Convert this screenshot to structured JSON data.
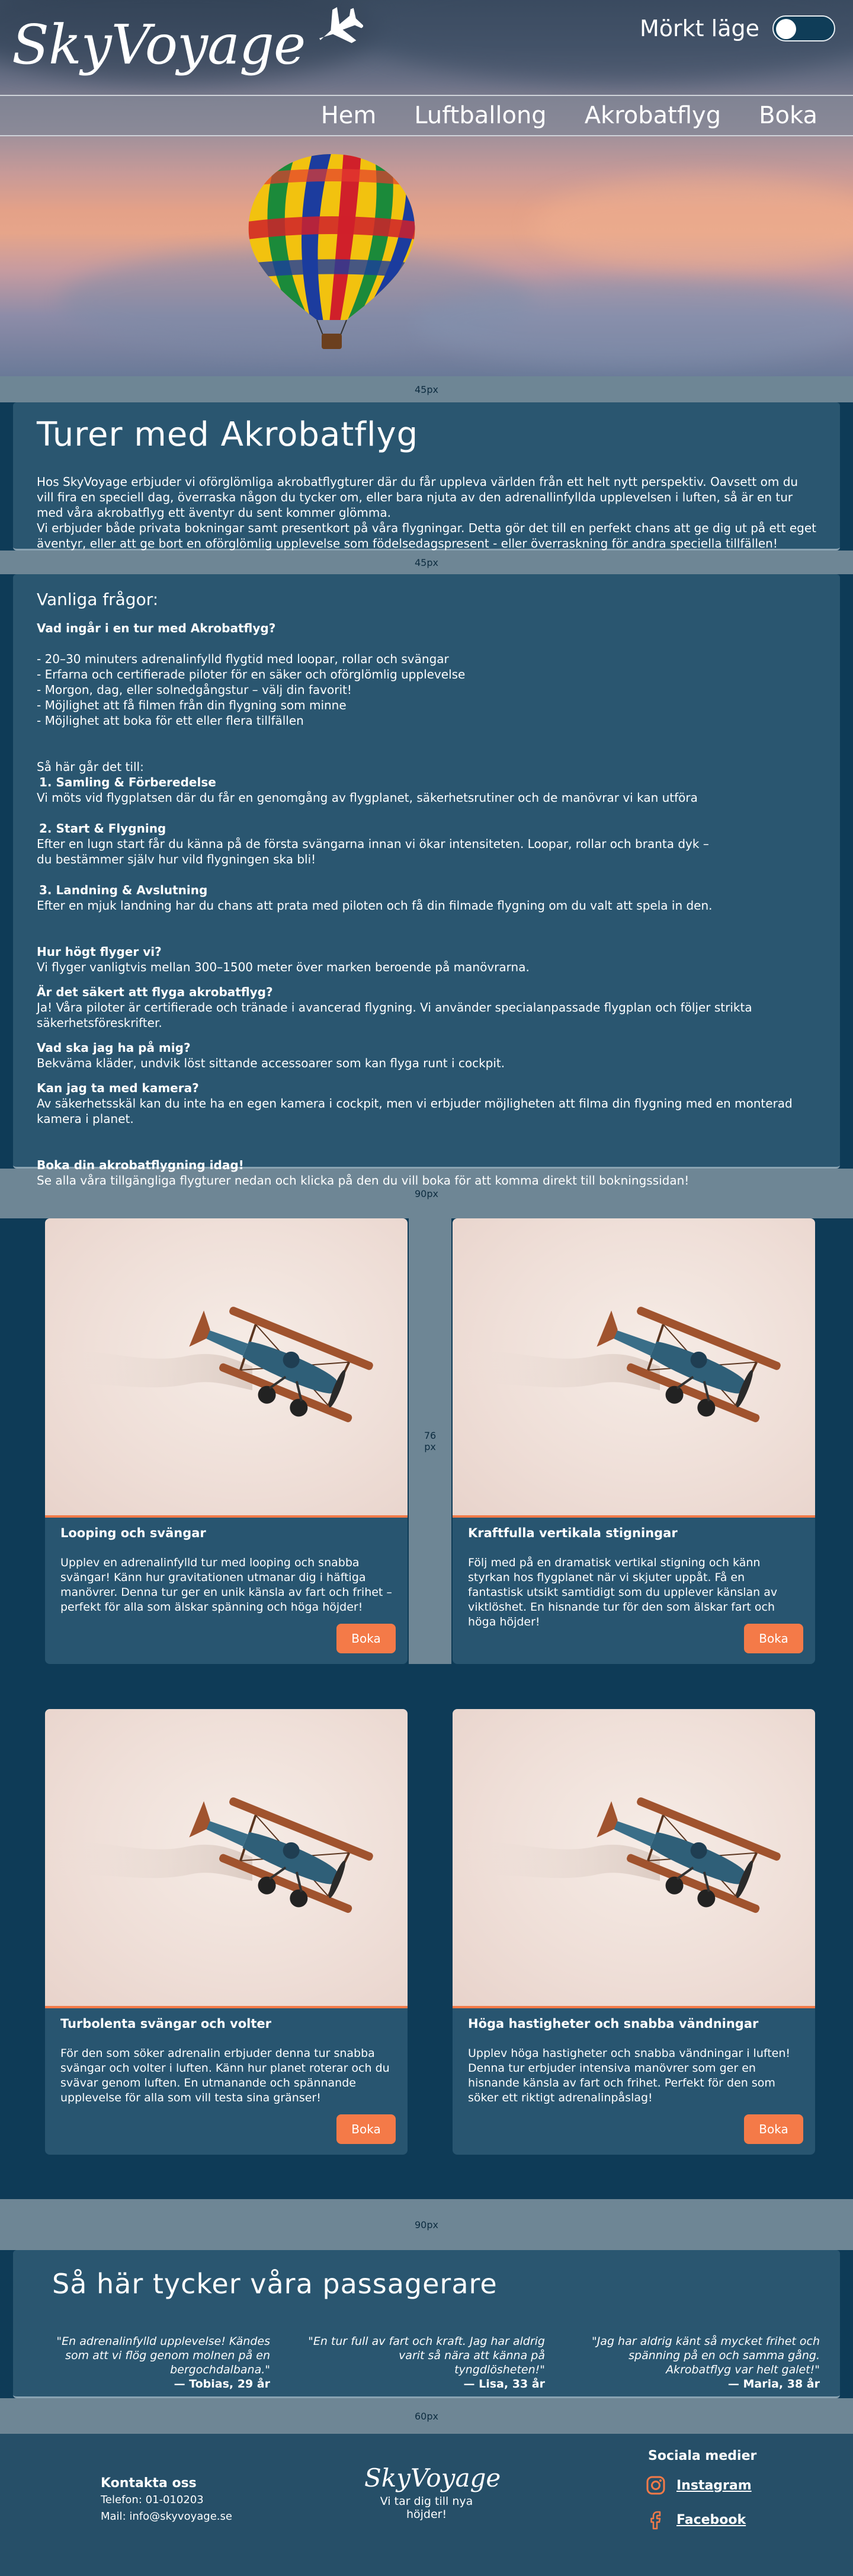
{
  "header": {
    "logo": "SkyVoyage",
    "dark_mode_label": "Mörkt läge",
    "nav": [
      "Hem",
      "Luftballong",
      "Akrobatflyg",
      "Boka"
    ]
  },
  "bands": {
    "b1": "45px",
    "b2": "45px",
    "b3": "90px",
    "b4": "90px",
    "b5": "60px",
    "mid": "76 px"
  },
  "intro": {
    "title": "Turer med Akrobatflyg",
    "p1": "Hos SkyVoyage erbjuder vi oförglömliga akrobatflygturer där du får uppleva världen från ett helt nytt perspektiv. Oavsett om du vill fira en speciell dag, överraska någon du tycker om, eller bara njuta av den adrenallinfyllda upplevelsen i luften, så är en tur med våra akrobatflyg ett äventyr du sent kommer glömma.",
    "p2": "Vi erbjuder både privata bokningar samt presentkort på våra flygningar. Detta gör det till en perfekt chans att ge dig ut på ett eget äventyr, eller att ge bort en oförglömlig upplevelse som födelsedagspresent - eller överraskning för andra speciella tillfällen!"
  },
  "faq": {
    "title": "Vanliga frågor:",
    "q1": "Vad ingår i en tur med Akrobatflyg?",
    "q1_items": [
      "- 20–30 minuters adrenalinfylld flygtid med loopar, rollar och svängar",
      "- Erfarna och certifierade piloter för en säker och oförglömlig upplevelse",
      "- Morgon, dag, eller solnedgångstur – välj din favorit!",
      "- Möjlighet att få filmen från din flygning som minne",
      "- Möjlighet att boka för ett eller flera tillfällen"
    ],
    "how_title": "Så här går det till:",
    "s1_title": "1. Samling & Förberedelse",
    "s1_text": "Vi möts vid flygplatsen där du får en genomgång av flygplanet, säkerhetsrutiner och de manövrar vi kan utföra",
    "s2_title": "2. Start & Flygning",
    "s2_text1": "Efter en lugn start får du känna på de första svängarna innan vi ökar intensiteten. Loopar, rollar och branta dyk –",
    "s2_text2": "du bestämmer själv hur vild flygningen ska bli!",
    "s3_title": "3. Landning & Avslutning",
    "s3_text": "Efter en mjuk landning har du chans att prata med piloten och få din filmade flygning om du valt att spela in den.",
    "q2": "Hur högt flyger vi?",
    "a2": "Vi flyger vanligtvis mellan 300–1500 meter över marken beroende på manövrarna.",
    "q3": "Är det säkert att flyga akrobatflyg?",
    "a3": "Ja! Våra piloter är certifierade och tränade i avancerad flygning. Vi använder specialanpassade flygplan och följer strikta säkerhetsföreskrifter.",
    "q4": "Vad ska jag ha på mig?",
    "a4": "Bekväma kläder, undvik löst sittande accessoarer som kan flyga runt i cockpit.",
    "q5": "Kan jag ta med kamera?",
    "a5": "Av säkerhetsskäl kan du inte ha en egen kamera i cockpit, men vi erbjuder möjligheten att filma din flygning med en monterad kamera i planet.",
    "cta_title": "Boka din akrobatflygning idag!",
    "cta_text": "Se alla våra tillgängliga flygturer nedan och klicka på den du vill boka för att komma direkt till bokningssidan!"
  },
  "tours": [
    {
      "title": "Looping och svängar",
      "desc": "Upplev en adrenalinfylld tur med looping och snabba svängar! Känn hur gravitationen utmanar dig i häftiga manövrer. Denna tur ger en unik känsla av fart och frihet – perfekt för alla som älskar spänning och höga höjder!",
      "button": "Boka"
    },
    {
      "title": "Kraftfulla vertikala stigningar",
      "desc": "Följ med på en dramatisk vertikal stigning och känn styrkan hos flygplanet när vi skjuter uppåt. Få en fantastisk utsikt samtidigt som du upplever känslan av viktlöshet. En hisnande tur för den som älskar fart och höga höjder!",
      "button": "Boka"
    },
    {
      "title": "Turbolenta svängar och volter",
      "desc": "För den som söker adrenalin erbjuder denna tur snabba svängar och volter i luften. Känn hur planet roterar och du svävar genom luften. En utmanande och spännande upplevelse för alla som vill testa sina gränser!",
      "button": "Boka"
    },
    {
      "title": "Höga hastigheter och snabba vändningar",
      "desc": "Upplev höga hastigheter och snabba vändningar i luften! Denna tur erbjuder intensiva manövrer som ger en hisnande känsla av fart och frihet. Perfekt för den som söker ett riktigt adrenalinpåslag!",
      "button": "Boka"
    }
  ],
  "testimonials": {
    "title": "Så här tycker våra passagerare",
    "items": [
      {
        "quote": "\"En adrenalinfylld upplevelse! Kändes som att vi flög genom molnen på en bergochdalbana.\"",
        "who": "— Tobias, 29 år"
      },
      {
        "quote": "\"En tur full av fart och kraft. Jag har aldrig varit så nära att känna på tyngdlösheten!\"",
        "who": "— Lisa, 33 år"
      },
      {
        "quote": "\"Jag har aldrig känt så mycket frihet och spänning på en och samma gång. Akrobatflyg var helt galet!\"",
        "who": "— Maria, 38 år"
      }
    ]
  },
  "footer": {
    "contact_title": "Kontakta oss",
    "phone": "Telefon: 01-010203",
    "email": "Mail: info@skyvoyage.se",
    "logo": "SkyVoyage",
    "tagline": "Vi tar dig till nya höjder!",
    "social_title": "Sociala medier",
    "instagram": "Instagram",
    "facebook": "Facebook"
  },
  "colors": {
    "background": "#0e3b57",
    "panel": "#2a5670",
    "band": "#6e8695",
    "accent": "#f47a48"
  },
  "icons": [
    "plane-icon",
    "toggle-switch",
    "balloon-image",
    "biplane-image",
    "instagram-icon",
    "facebook-icon"
  ]
}
